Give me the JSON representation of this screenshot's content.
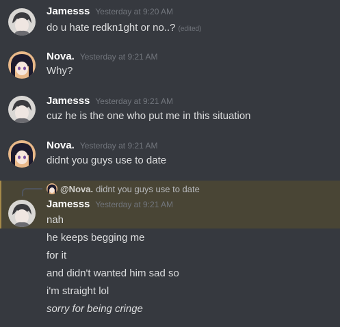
{
  "messages": [
    {
      "username": "Jamesss",
      "timestamp": "Yesterday at 9:20 AM",
      "avatar": "jamesss-avatar",
      "lines": [
        "do u hate redkn1ght or no..?"
      ],
      "edited_label": "(edited)"
    },
    {
      "username": "Nova.",
      "timestamp": "Yesterday at 9:21 AM",
      "avatar": "nova-avatar",
      "lines": [
        "Why?"
      ]
    },
    {
      "username": "Jamesss",
      "timestamp": "Yesterday at 9:21 AM",
      "avatar": "jamesss-avatar",
      "lines": [
        "cuz he is the one who put me in this situation"
      ]
    },
    {
      "username": "Nova.",
      "timestamp": "Yesterday at 9:21 AM",
      "avatar": "nova-avatar",
      "lines": [
        "didnt you guys use to date"
      ]
    },
    {
      "username": "Jamesss",
      "timestamp": "Yesterday at 9:21 AM",
      "avatar": "jamesss-avatar",
      "reply": {
        "username": "@Nova.",
        "text": "didnt you guys use to date"
      },
      "lines": [
        "nah",
        "he keeps begging me",
        "for it",
        "and didn't wanted him sad so",
        "i'm straight lol",
        "sorry for being cringe"
      ]
    }
  ],
  "colors": {
    "background": "#36393f",
    "mention_highlight": "#494535",
    "mention_bar": "#a58a4a",
    "username": "#ffffff",
    "timestamp": "#72767d",
    "message_text": "#dcddde"
  }
}
